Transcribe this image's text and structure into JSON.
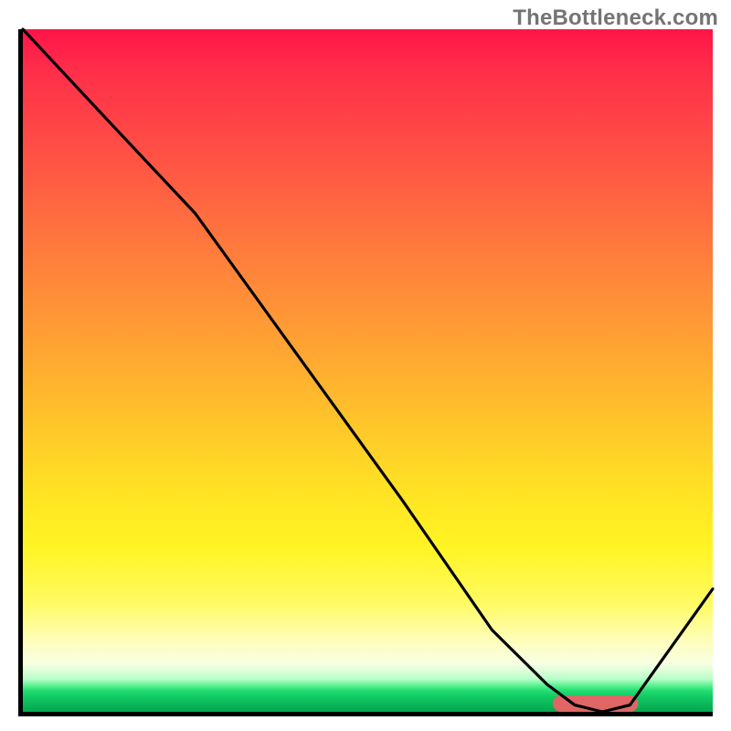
{
  "watermark": "TheBottleneck.com",
  "chart_data": {
    "type": "line",
    "title": "",
    "xlabel": "",
    "ylabel": "",
    "xlim": [
      0,
      100
    ],
    "ylim": [
      0,
      100
    ],
    "grid": false,
    "series": [
      {
        "name": "curve",
        "x": [
          0,
          12,
          25,
          40,
          55,
          68,
          76,
          80,
          84,
          88,
          100
        ],
        "y": [
          100,
          87,
          73,
          52,
          31,
          12,
          4,
          1,
          0,
          1,
          18
        ]
      }
    ],
    "sweet_spot": {
      "x_start": 78,
      "x_end": 88,
      "y": 1.2
    },
    "gradient_stops": [
      {
        "pct": 0,
        "color": "#ff1448"
      },
      {
        "pct": 50,
        "color": "#ffb030"
      },
      {
        "pct": 80,
        "color": "#fff425"
      },
      {
        "pct": 95,
        "color": "#c8ffd4"
      },
      {
        "pct": 100,
        "color": "#06a74f"
      }
    ]
  }
}
